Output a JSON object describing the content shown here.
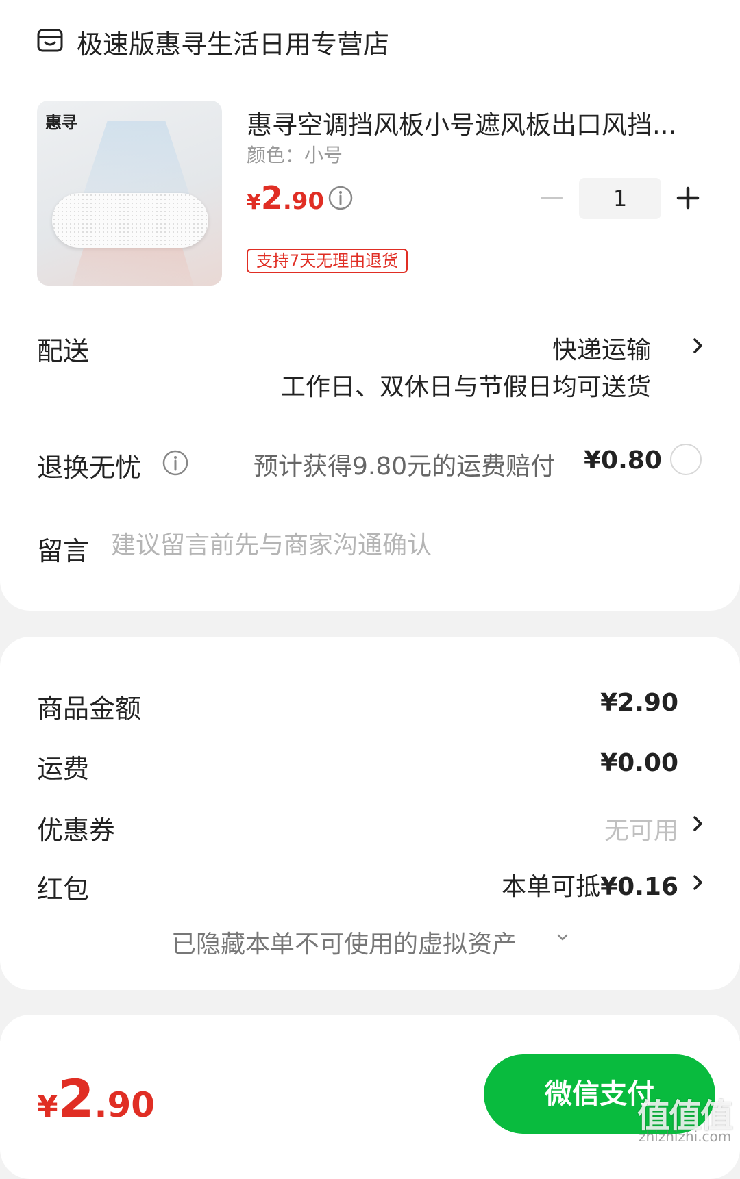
{
  "store": {
    "icon": "store-icon",
    "name": "极速版惠寻生活日用专营店"
  },
  "product": {
    "image_brand": "惠寻",
    "title": "惠寻空调挡风板小号遮风板出口风挡...",
    "spec": "颜色：小号",
    "price": {
      "currency": "¥",
      "integer": "2",
      "decimal": ".90"
    },
    "quantity": "1",
    "return_badge": "支持7天无理由退货"
  },
  "delivery": {
    "label": "配送",
    "method": "快递运输",
    "note": "工作日、双休日与节假日均可送货"
  },
  "return_insurance": {
    "label": "退换无忧",
    "description": "预计获得9.80元的运费赔付",
    "price": "¥0.80",
    "selected": false
  },
  "message": {
    "label": "留言",
    "placeholder": "建议留言前先与商家沟通确认",
    "value": ""
  },
  "summary": {
    "goods_label": "商品金额",
    "goods_value": "¥2.90",
    "shipping_label": "运费",
    "shipping_value": "¥0.00",
    "coupon_label": "优惠券",
    "coupon_value": "无可用",
    "redpacket_label": "红包",
    "redpacket_prefix": "本单可抵",
    "redpacket_value": "¥0.16",
    "hidden_assets": "已隐藏本单不可使用的虚拟资产"
  },
  "footer": {
    "total": {
      "currency": "¥",
      "integer": "2",
      "decimal": ".90"
    },
    "pay_label": "微信支付",
    "watermark": "值值值",
    "watermark_url": "zhizhizhi.com"
  },
  "colors": {
    "accent_red": "#e02e24",
    "pay_green": "#09bb3e"
  }
}
